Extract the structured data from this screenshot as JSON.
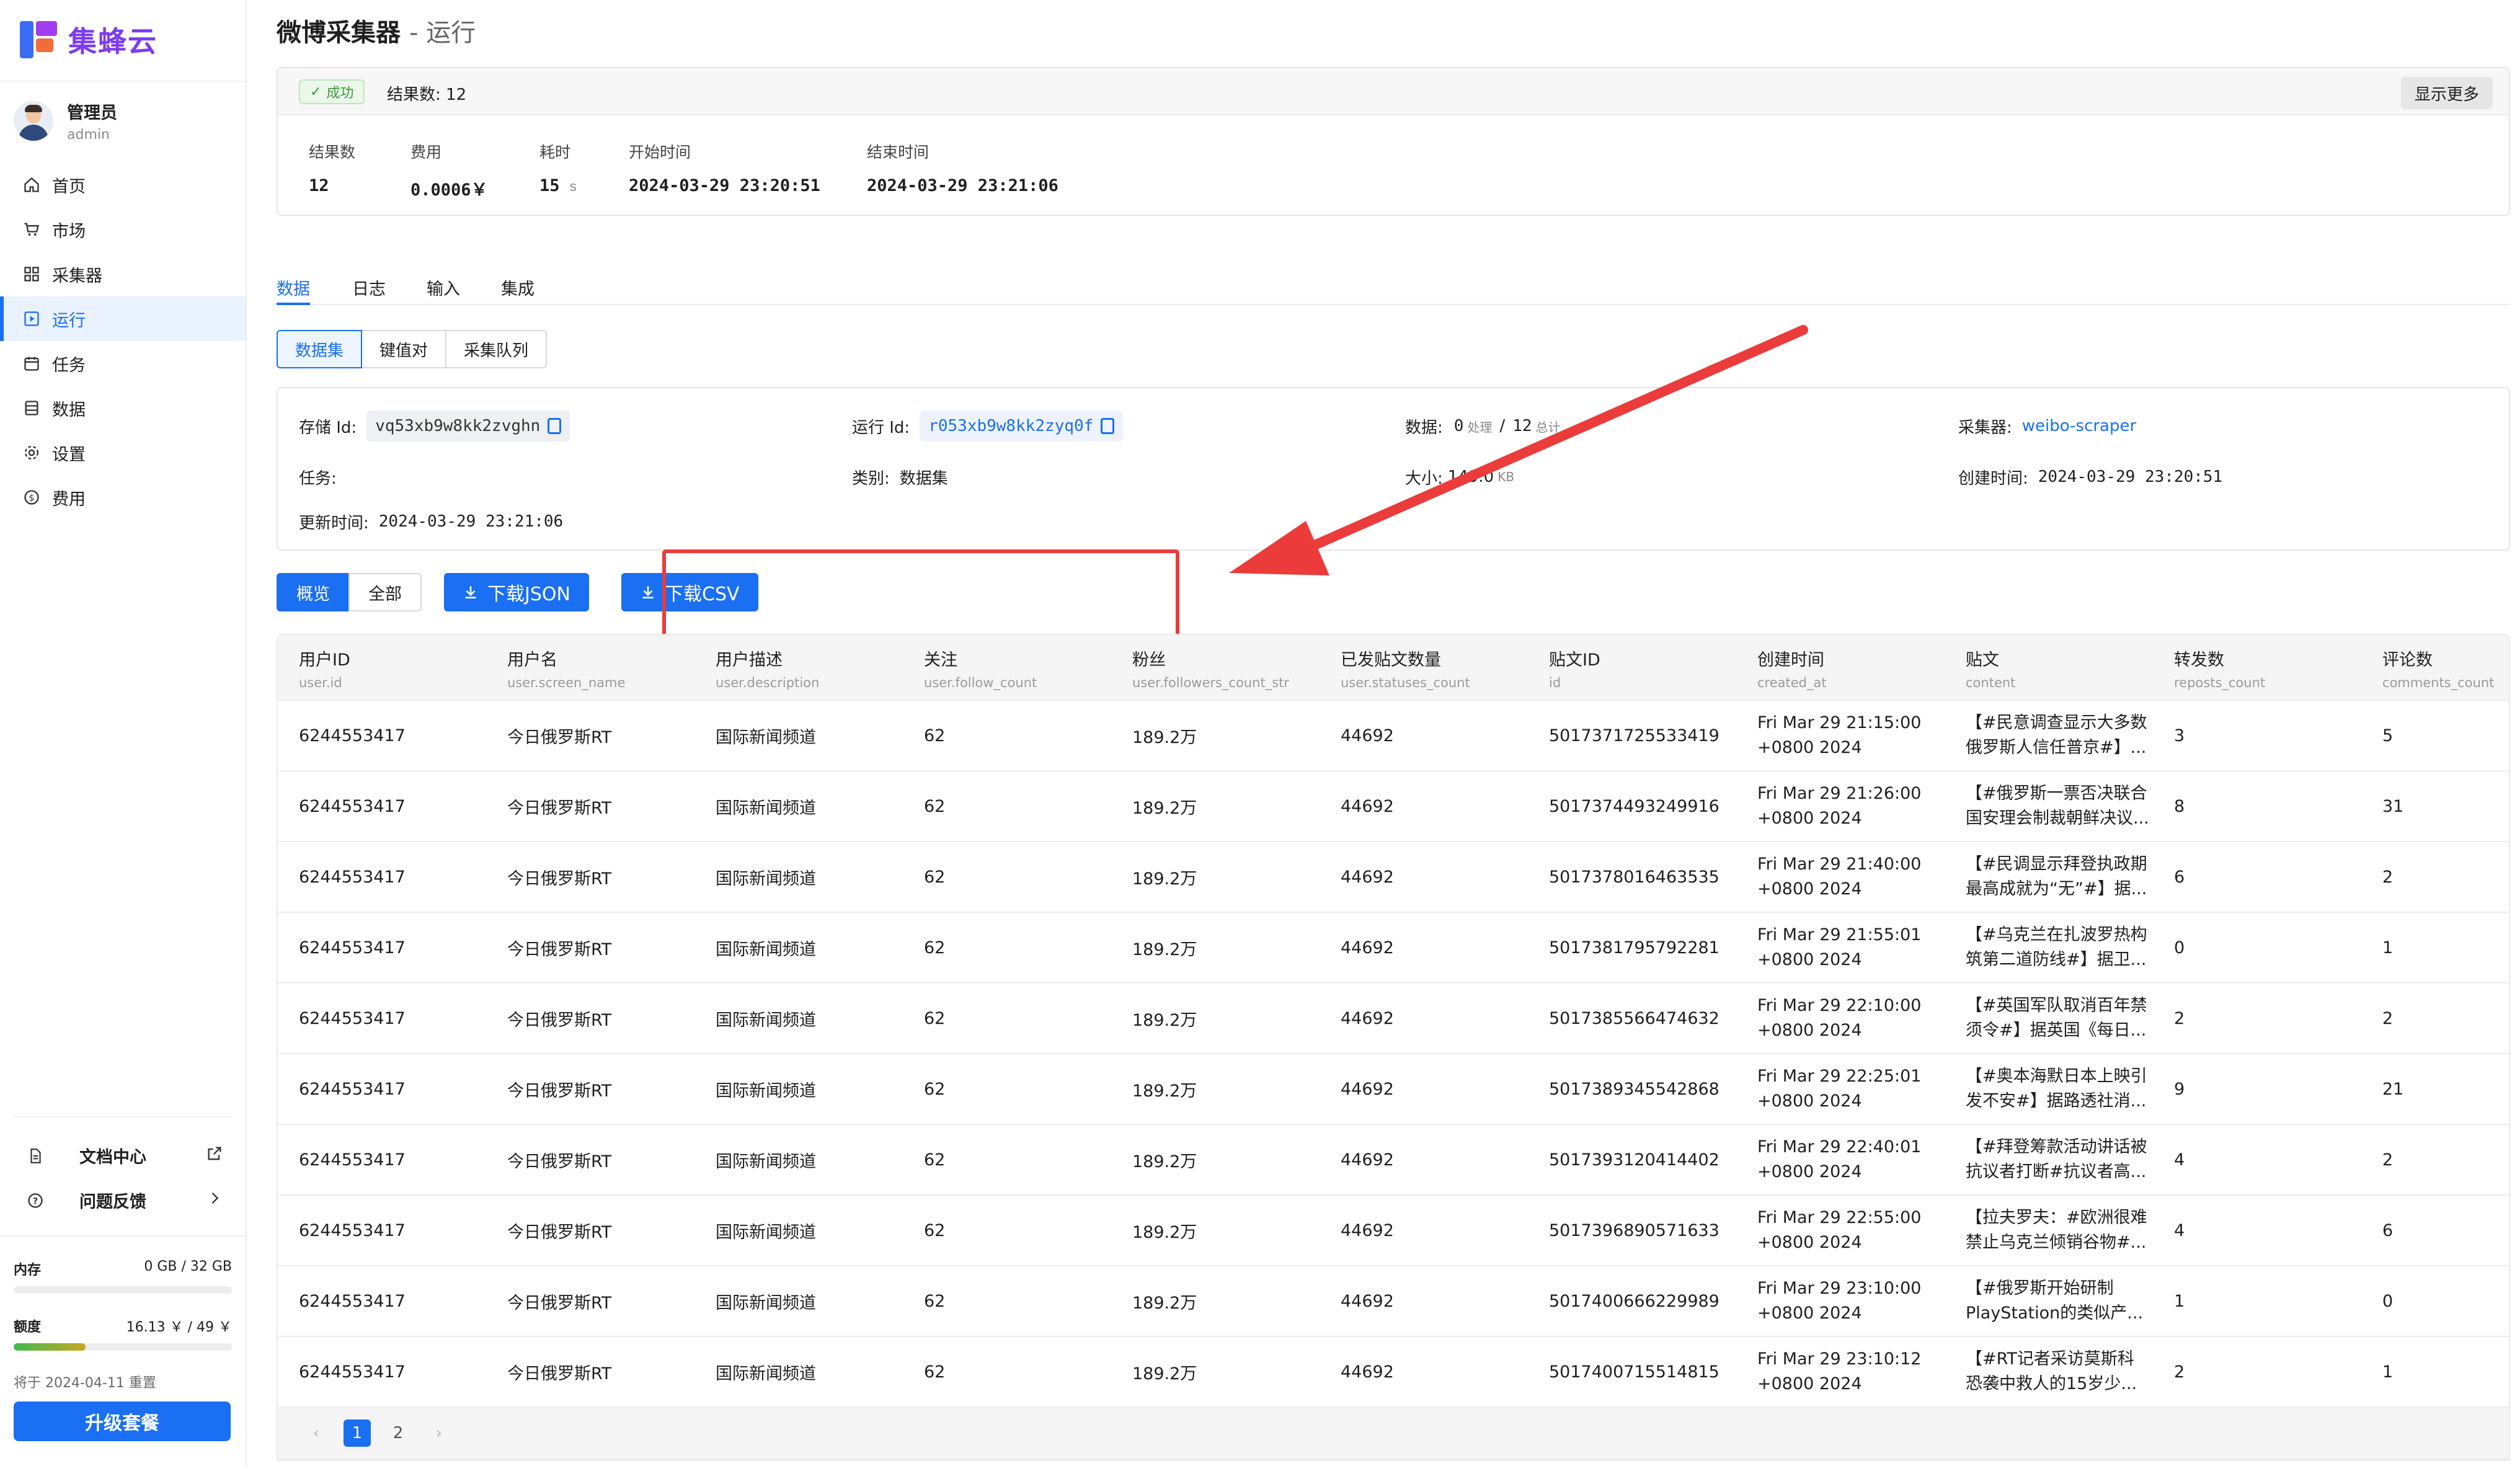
{
  "app": {
    "name": "集蜂云"
  },
  "user": {
    "name": "管理员",
    "role": "admin"
  },
  "nav": [
    {
      "label": "首页",
      "icon": "home-icon"
    },
    {
      "label": "市场",
      "icon": "cart-icon"
    },
    {
      "label": "采集器",
      "icon": "grid-icon"
    },
    {
      "label": "运行",
      "icon": "run-icon",
      "active": true
    },
    {
      "label": "任务",
      "icon": "calendar-icon"
    },
    {
      "label": "数据",
      "icon": "database-icon"
    },
    {
      "label": "设置",
      "icon": "gear-icon"
    },
    {
      "label": "费用",
      "icon": "coin-icon"
    }
  ],
  "sidebar_bottom": {
    "docs": "文档中心",
    "feedback": "问题反馈",
    "memory_label": "内存",
    "memory_value": "0 GB / 32 GB",
    "memory_fraction": 0.0,
    "quota_label": "额度",
    "quota_value": "16.13 ￥ / 49 ￥",
    "quota_fraction": 0.33,
    "reset_note": "将于 2024-04-11 重置",
    "upgrade": "升级套餐"
  },
  "page": {
    "title": "微博采集器",
    "subtitle": "- 运行"
  },
  "status": {
    "badge": "成功",
    "result_count": "结果数: 12",
    "show_more": "显示更多",
    "stats": [
      {
        "label": "结果数",
        "value": "12",
        "unit": ""
      },
      {
        "label": "费用",
        "value": "0.0006￥",
        "unit": ""
      },
      {
        "label": "耗时",
        "value": "15",
        "unit": "s"
      },
      {
        "label": "开始时间",
        "value": "2024-03-29 23:20:51",
        "unit": ""
      },
      {
        "label": "结束时间",
        "value": "2024-03-29 23:21:06",
        "unit": ""
      }
    ]
  },
  "tabs": [
    "数据",
    "日志",
    "输入",
    "集成"
  ],
  "segments": [
    "数据集",
    "键值对",
    "采集队列"
  ],
  "meta": {
    "storage_label": "存储 Id:",
    "storage_id": "vq53xb9w8kk2zvghn",
    "run_label": "运行 Id:",
    "run_id": "r053xb9w8kk2zyq0f",
    "data_label": "数据:",
    "data_processed": "0",
    "data_processed_unit": "处理",
    "data_sep": "/",
    "data_total": "12",
    "data_total_unit": "总计",
    "scraper_label": "采集器:",
    "scraper_link": "weibo-scraper",
    "task_label": "任务:",
    "type_label": "类别:",
    "type_value": "数据集",
    "size_label": "大小:",
    "size_value": "149.0",
    "size_unit": "KB",
    "created_label": "创建时间:",
    "created_value": "2024-03-29 23:20:51",
    "updated_label": "更新时间:",
    "updated_value": "2024-03-29 23:21:06"
  },
  "view": {
    "overview": "概览",
    "all": "全部",
    "download_json": "下载JSON",
    "download_csv": "下载CSV"
  },
  "annotation": {
    "highlight_color": "#ec3b3b"
  },
  "table": {
    "columns": [
      {
        "title": "用户ID",
        "field": "user.id"
      },
      {
        "title": "用户名",
        "field": "user.screen_name"
      },
      {
        "title": "用户描述",
        "field": "user.description"
      },
      {
        "title": "关注",
        "field": "user.follow_count"
      },
      {
        "title": "粉丝",
        "field": "user.followers_count_str"
      },
      {
        "title": "已发贴文数量",
        "field": "user.statuses_count"
      },
      {
        "title": "贴文ID",
        "field": "id"
      },
      {
        "title": "创建时间",
        "field": "created_at"
      },
      {
        "title": "贴文",
        "field": "content"
      },
      {
        "title": "转发数",
        "field": "reposts_count"
      },
      {
        "title": "评论数",
        "field": "comments_count"
      }
    ],
    "rows": [
      [
        "6244553417",
        "今日俄罗斯RT",
        "国际新闻频道",
        "62",
        "189.2万",
        "44692",
        "5017371725533419",
        "Fri Mar 29 21:15:00",
        "+0800 2024",
        "【#民意调查显示大多数",
        "俄罗斯人信任普京#】...",
        "3",
        "5"
      ],
      [
        "6244553417",
        "今日俄罗斯RT",
        "国际新闻频道",
        "62",
        "189.2万",
        "44692",
        "5017374493249916",
        "Fri Mar 29 21:26:00",
        "+0800 2024",
        "【#俄罗斯一票否决联合",
        "国安理会制裁朝鲜决议...",
        "8",
        "31"
      ],
      [
        "6244553417",
        "今日俄罗斯RT",
        "国际新闻频道",
        "62",
        "189.2万",
        "44692",
        "5017378016463535",
        "Fri Mar 29 21:40:00",
        "+0800 2024",
        "【#民调显示拜登执政期",
        "最高成就为“无”#】据...",
        "6",
        "2"
      ],
      [
        "6244553417",
        "今日俄罗斯RT",
        "国际新闻频道",
        "62",
        "189.2万",
        "44692",
        "5017381795792281",
        "Fri Mar 29 21:55:01",
        "+0800 2024",
        "【#乌克兰在扎波罗热构",
        "筑第二道防线#】据卫...",
        "0",
        "1"
      ],
      [
        "6244553417",
        "今日俄罗斯RT",
        "国际新闻频道",
        "62",
        "189.2万",
        "44692",
        "5017385566474632",
        "Fri Mar 29 22:10:00",
        "+0800 2024",
        "【#英国军队取消百年禁",
        "须令#】据英国《每日...",
        "2",
        "2"
      ],
      [
        "6244553417",
        "今日俄罗斯RT",
        "国际新闻频道",
        "62",
        "189.2万",
        "44692",
        "5017389345542868",
        "Fri Mar 29 22:25:01",
        "+0800 2024",
        "【#奥本海默日本上映引",
        "发不安#】据路透社消...",
        "9",
        "21"
      ],
      [
        "6244553417",
        "今日俄罗斯RT",
        "国际新闻频道",
        "62",
        "189.2万",
        "44692",
        "5017393120414402",
        "Fri Mar 29 22:40:01",
        "+0800 2024",
        "【#拜登筹款活动讲话被",
        "抗议者打断#抗议者高...",
        "4",
        "2"
      ],
      [
        "6244553417",
        "今日俄罗斯RT",
        "国际新闻频道",
        "62",
        "189.2万",
        "44692",
        "5017396890571633",
        "Fri Mar 29 22:55:00",
        "+0800 2024",
        "【拉夫罗夫：#欧洲很难",
        "禁止乌克兰倾销谷物#...",
        "4",
        "6"
      ],
      [
        "6244553417",
        "今日俄罗斯RT",
        "国际新闻频道",
        "62",
        "189.2万",
        "44692",
        "5017400666229989",
        "Fri Mar 29 23:10:00",
        "+0800 2024",
        "【#俄罗斯开始研制",
        "PlayStation的类似产...",
        "1",
        "0"
      ],
      [
        "6244553417",
        "今日俄罗斯RT",
        "国际新闻频道",
        "62",
        "189.2万",
        "44692",
        "5017400715514815",
        "Fri Mar 29 23:10:12",
        "+0800 2024",
        "【#RT记者采访莫斯科",
        "恐袭中救人的15岁少...",
        "2",
        "1"
      ]
    ]
  },
  "pagination": {
    "prev": "‹",
    "pages": [
      "1",
      "2"
    ],
    "next": "›",
    "current": "1"
  }
}
